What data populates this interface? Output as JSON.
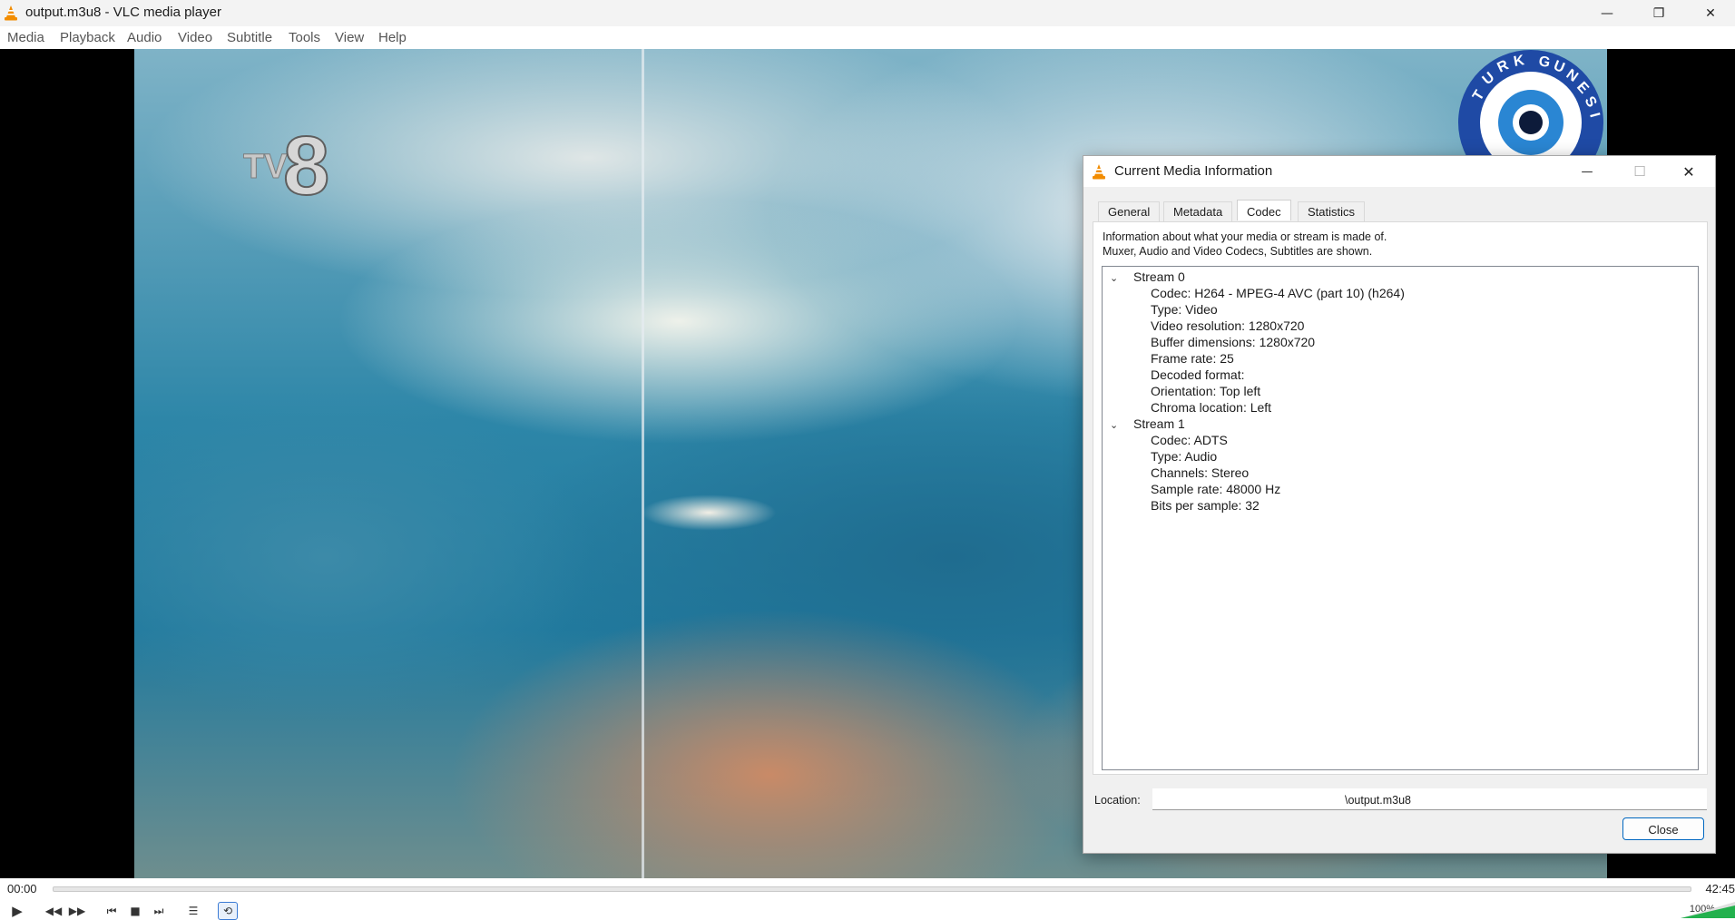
{
  "window": {
    "title": "output.m3u8 - VLC media player",
    "minimize_glyph": "—",
    "restore_glyph": "❐",
    "close_glyph": "✕"
  },
  "menu": {
    "items": [
      "Media",
      "Playback",
      "Audio",
      "Video",
      "Subtitle",
      "Tools",
      "View",
      "Help"
    ]
  },
  "video": {
    "channel_logo_text": "TV8",
    "overlay_logo_text": "TURK GUNESI"
  },
  "playback": {
    "elapsed": "00:00",
    "duration": "42:45",
    "progress_fraction": 0.0,
    "volume": "100%"
  },
  "dialog": {
    "title": "Current Media Information",
    "minimize_glyph": "—",
    "maximize_glyph": "☐",
    "close_glyph": "✕",
    "tabs": [
      "General",
      "Metadata",
      "Codec",
      "Statistics"
    ],
    "active_tab": "Codec",
    "info_line1": "Information about what your media or stream is made of.",
    "info_line2": "Muxer, Audio and Video Codecs, Subtitles are shown.",
    "streams": [
      {
        "label": "Stream 0",
        "fields": [
          "Codec: H264 - MPEG-4 AVC (part 10) (h264)",
          "Type: Video",
          "Video resolution: 1280x720",
          "Buffer dimensions: 1280x720",
          "Frame rate: 25",
          "Decoded format:",
          "Orientation: Top left",
          "Chroma location: Left"
        ]
      },
      {
        "label": "Stream 1",
        "fields": [
          "Codec: ADTS",
          "Type: Audio",
          "Channels: Stereo",
          "Sample rate: 48000 Hz",
          "Bits per sample: 32"
        ]
      }
    ],
    "location_label": "Location:",
    "location_value": "\\output.m3u8",
    "close_label": "Close"
  },
  "colors": {
    "accent": "#0067c0",
    "vlc_orange": "#f28c00"
  }
}
